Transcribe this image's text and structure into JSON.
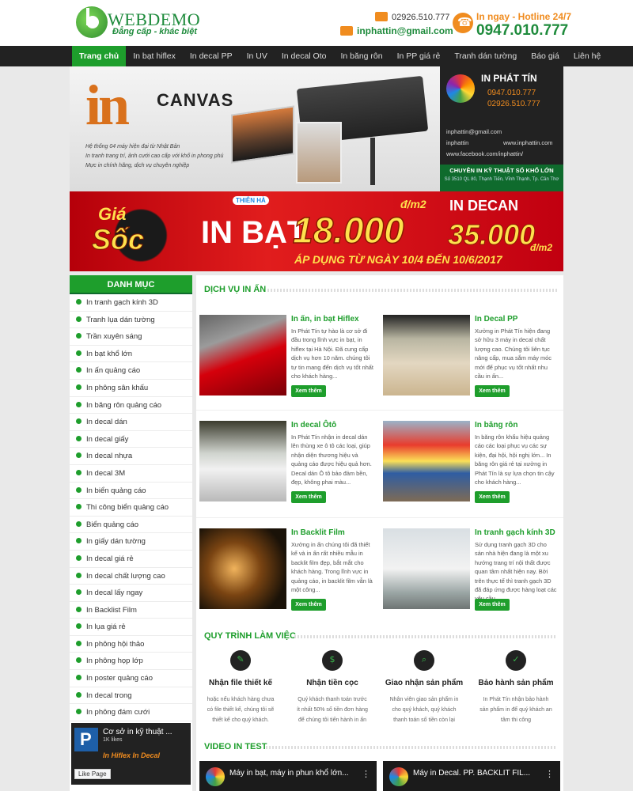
{
  "header": {
    "logo_text": "WEBDEMO",
    "slogan": "Đẳng cấp - khác biệt",
    "phone": "02926.510.777",
    "email": "inphattin@gmail.com",
    "hotline_label": "In ngay - Hotline 24/7",
    "hotline_number": "0947.010.777"
  },
  "nav": {
    "items": [
      "Trang chủ",
      "In bạt hiflex",
      "In decal PP",
      "In UV",
      "In decal Oto",
      "In băng rôn",
      "In PP giá rẻ",
      "Tranh dán tường",
      "Báo giá",
      "Liên hệ"
    ]
  },
  "hero": {
    "big_in": "in",
    "canvas": "CANVAS",
    "desc": [
      "Hệ thống 04 máy hiện đại từ Nhật Bản",
      "In tranh trang trí, ảnh cưới cao cấp với khổ in phong phú",
      "Mực in chính hãng, dịch vụ chuyên nghiệp"
    ],
    "side": {
      "name": "IN PHÁT TÍN",
      "phone1": "0947.010.777",
      "phone2": "02926.510.777",
      "email": "inphattin@gmail.com",
      "skype": "inphattin",
      "web": "www.inphattin.com",
      "facebook": "www.facebook.com/inphattin/",
      "tagline": "CHUYÊN IN KỸ THUẬT SỐ KHỔ LỚN",
      "address": "Số 3510 QL 80, Thạnh Tiến, Vĩnh Thạnh, Tp. Cần Thơ"
    }
  },
  "promo": {
    "gia": "Giá",
    "soc": "Sốc",
    "brand": "THIÊN HÀ",
    "in_bat": "IN BẠT",
    "price1": "18.000",
    "unit1": "đ/m2",
    "in_decan": "IN DECAN",
    "price2": "35.000",
    "unit2": "đ/m2",
    "apply": "ÁP DỤNG TỪ NGÀY 10/4 ĐẾN 10/6/2017"
  },
  "sidebar": {
    "title": "DANH MỤC",
    "items": [
      "In tranh gạch kính 3D",
      "Tranh lụa dán tường",
      "Trần xuyên sáng",
      "In bạt khổ lớn",
      "In ấn quảng cáo",
      "In phông sân khấu",
      "In băng rôn quảng cáo",
      "In decal dán",
      "In decal giấy",
      "In decal nhựa",
      "In decal 3M",
      "In biển quảng cáo",
      "Thi công biển quảng cáo",
      "Biển quảng cáo",
      "In giấy dán tường",
      "In decal giá rẻ",
      "In decal chất lượng cao",
      "In decal lấy ngay",
      "In Backlist Film",
      "In lụa giá rẻ",
      "In phông hội thảo",
      "In phông họp lớp",
      "In poster quảng cáo",
      "In decal trong",
      "In phông đám cưới"
    ],
    "fb": {
      "name": "Cơ sở in kỹ thuật ...",
      "likes": "1K likes",
      "sub": "In Hiflex   In Decal",
      "like": "Like Page"
    }
  },
  "services": {
    "title": "DỊCH VỤ IN ẤN",
    "more_label": "Xem thêm",
    "cards": [
      {
        "title": "In ấn, in bạt Hiflex",
        "desc": "In Phát Tín tự hào là cơ sở đi đầu trong lĩnh vực in bạt, in hiflex tại Hà Nội. Đã cung cấp dịch vụ hơn 10 năm. chúng tôi tự tin mang đến dịch vụ tốt nhất cho khách hàng..."
      },
      {
        "title": "In Decal PP",
        "desc": "Xưởng in Phát Tín hiện đang sở hữu 3 máy in decal chất lượng cao. Chúng tôi liên tục nâng cấp, mua sắm máy móc mới để phục vụ tốt nhất nhu cầu in ấn..."
      },
      {
        "title": "In decal Ôtô",
        "desc": "In Phát Tín nhận in decal dán lên thùng xe ô tô các loại, giúp nhận diện thương hiệu và quảng cáo được hiệu quả hơn. Decal dán Ô tô bảo đảm bền, đẹp, không phai màu..."
      },
      {
        "title": "In băng rôn",
        "desc": "In băng rôn khẩu hiệu quảng cáo các loại phục vụ các sự kiện, đại hội, hội nghị lớn... In băng rôn giá rẻ tại xưởng in Phát Tín là sự lựa chọn tin cậy cho khách hàng..."
      },
      {
        "title": "In Backlit Film",
        "desc": "Xưởng in ấn chúng tôi đã thiết kế và in ấn rất nhiều mẫu in backlit film đẹp, bắt mắt cho khách hàng. Trong lĩnh vực in quảng cáo, in backlit film vẫn là một công..."
      },
      {
        "title": "In tranh gạch kính 3D",
        "desc": "Sử dụng tranh gạch 3D cho sản nhà hiện đang là một xu hướng trang trí nội thất được quan tâm nhất hiện nay. Bởi trên thực tế thì tranh gạch 3D đã đáp ứng được hàng loạt các yêu cầu..."
      }
    ]
  },
  "process": {
    "title": "QUY TRÌNH LÀM VIỆC",
    "steps": [
      {
        "icon": "design-tools-icon",
        "title": "Nhận file thiết kế",
        "desc": "hoặc nếu khách hàng chưa có file thiết kế, chúng tôi sẽ thiết kế cho quý khách."
      },
      {
        "icon": "money-icon",
        "title": "Nhận tiền cọc",
        "desc": "Quý khách thanh toán trước ít nhất 50% số tiền đơn hàng để chúng tôi tiến hành in ấn"
      },
      {
        "icon": "delivery-icon",
        "title": "Giao nhận sản phẩm",
        "desc": "Nhân viên giao sản phẩm in cho quý khách, quý khách thanh toán số tiền còn lại"
      },
      {
        "icon": "shield-check-icon",
        "title": "Bảo hành sản phẩm",
        "desc": "In Phát Tín nhận bảo hành sản phẩm in để quý khách an tâm thi công"
      }
    ]
  },
  "videos": {
    "title": "VIDEO IN TEST",
    "items": [
      {
        "title": "Máy in bạt, máy in phun khổ lớn..."
      },
      {
        "title": "Máy in Decal. PP. BACKLIT FIL..."
      }
    ]
  }
}
